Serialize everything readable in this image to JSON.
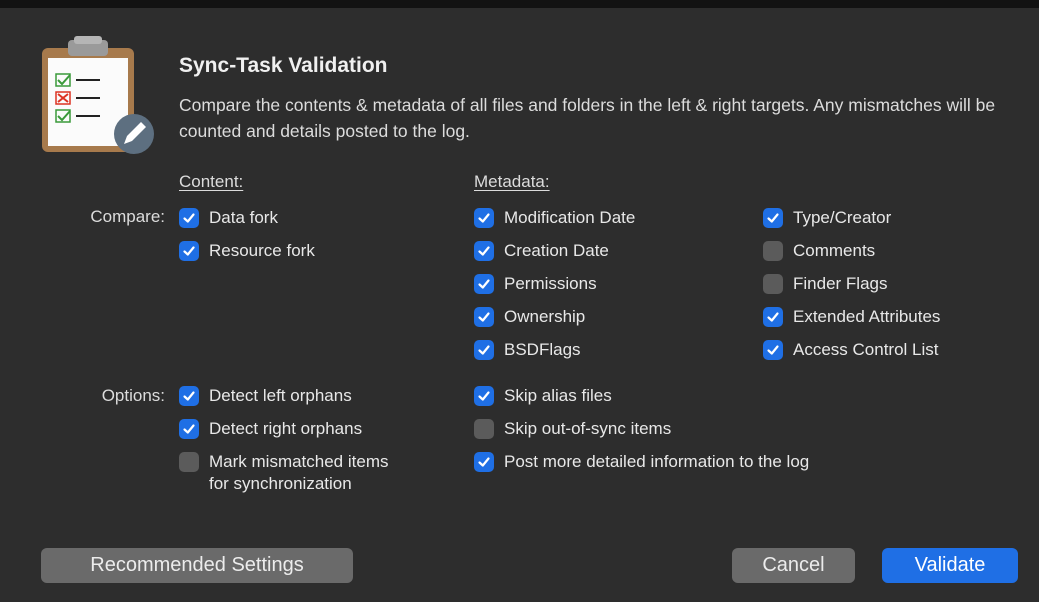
{
  "dialog": {
    "title": "Sync-Task Validation",
    "description": "Compare the contents & metadata of all files and folders in the left & right targets. Any mismatches will be counted and details posted to the log."
  },
  "headers": {
    "content": "Content:",
    "metadata": "Metadata:"
  },
  "labels": {
    "compare": "Compare:",
    "options": "Options:"
  },
  "content": [
    {
      "label": "Data fork",
      "checked": true
    },
    {
      "label": "Resource fork",
      "checked": true
    }
  ],
  "metadata_col1": [
    {
      "label": "Modification Date",
      "checked": true
    },
    {
      "label": "Creation Date",
      "checked": true
    },
    {
      "label": "Permissions",
      "checked": true
    },
    {
      "label": "Ownership",
      "checked": true
    },
    {
      "label": "BSDFlags",
      "checked": true
    }
  ],
  "metadata_col2": [
    {
      "label": "Type/Creator",
      "checked": true
    },
    {
      "label": "Comments",
      "checked": false
    },
    {
      "label": "Finder Flags",
      "checked": false
    },
    {
      "label": "Extended Attributes",
      "checked": true
    },
    {
      "label": "Access Control List",
      "checked": true
    }
  ],
  "options_col1": [
    {
      "label": "Detect left orphans",
      "checked": true
    },
    {
      "label": "Detect right orphans",
      "checked": true
    },
    {
      "label": "Mark mismatched items\nfor synchronization",
      "checked": false
    }
  ],
  "options_col2": [
    {
      "label": "Skip alias files",
      "checked": true
    },
    {
      "label": "Skip out-of-sync items",
      "checked": false
    },
    {
      "label": "Post more detailed information to the log",
      "checked": true
    }
  ],
  "buttons": {
    "recommended": "Recommended Settings",
    "cancel": "Cancel",
    "validate": "Validate"
  },
  "colors": {
    "accent": "#1f6fe5",
    "unchecked": "#5b5b5b",
    "background": "#2d2d2d"
  }
}
